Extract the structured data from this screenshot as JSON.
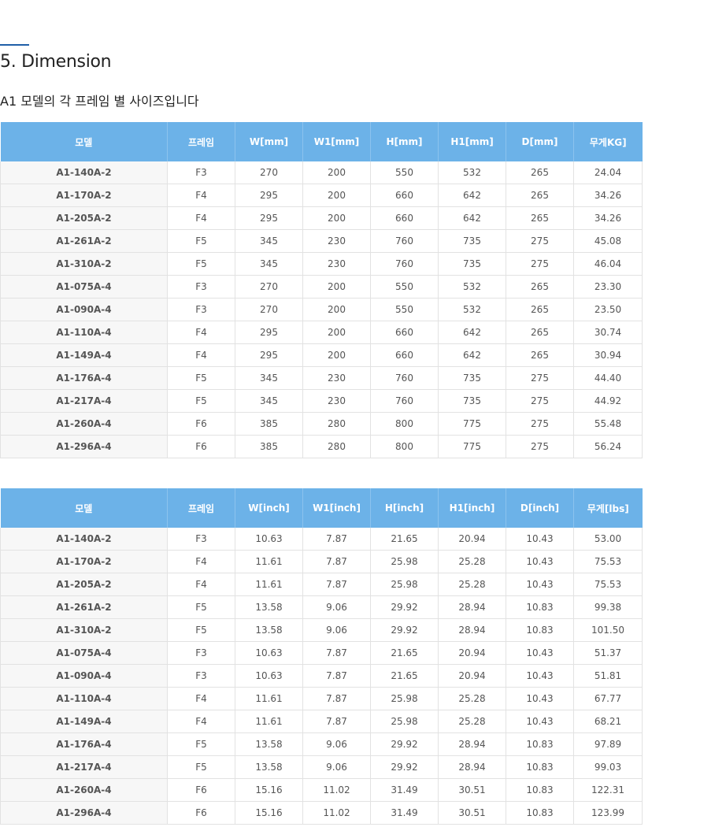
{
  "section": {
    "title": "5. Dimension",
    "subtitle": "A1 모델의 각 프레임 별 사이즈입니다"
  },
  "tables": [
    {
      "headers": [
        "모델",
        "프레임",
        "W[mm]",
        "W1[mm]",
        "H[mm]",
        "H1[mm]",
        "D[mm]",
        "무게KG]"
      ],
      "rows": [
        [
          "A1-140A-2",
          "F3",
          "270",
          "200",
          "550",
          "532",
          "265",
          "24.04"
        ],
        [
          "A1-170A-2",
          "F4",
          "295",
          "200",
          "660",
          "642",
          "265",
          "34.26"
        ],
        [
          "A1-205A-2",
          "F4",
          "295",
          "200",
          "660",
          "642",
          "265",
          "34.26"
        ],
        [
          "A1-261A-2",
          "F5",
          "345",
          "230",
          "760",
          "735",
          "275",
          "45.08"
        ],
        [
          "A1-310A-2",
          "F5",
          "345",
          "230",
          "760",
          "735",
          "275",
          "46.04"
        ],
        [
          "A1-075A-4",
          "F3",
          "270",
          "200",
          "550",
          "532",
          "265",
          "23.30"
        ],
        [
          "A1-090A-4",
          "F3",
          "270",
          "200",
          "550",
          "532",
          "265",
          "23.50"
        ],
        [
          "A1-110A-4",
          "F4",
          "295",
          "200",
          "660",
          "642",
          "265",
          "30.74"
        ],
        [
          "A1-149A-4",
          "F4",
          "295",
          "200",
          "660",
          "642",
          "265",
          "30.94"
        ],
        [
          "A1-176A-4",
          "F5",
          "345",
          "230",
          "760",
          "735",
          "275",
          "44.40"
        ],
        [
          "A1-217A-4",
          "F5",
          "345",
          "230",
          "760",
          "735",
          "275",
          "44.92"
        ],
        [
          "A1-260A-4",
          "F6",
          "385",
          "280",
          "800",
          "775",
          "275",
          "55.48"
        ],
        [
          "A1-296A-4",
          "F6",
          "385",
          "280",
          "800",
          "775",
          "275",
          "56.24"
        ]
      ]
    },
    {
      "headers": [
        "모델",
        "프레임",
        "W[inch]",
        "W1[inch]",
        "H[inch]",
        "H1[inch]",
        "D[inch]",
        "무게[lbs]"
      ],
      "rows": [
        [
          "A1-140A-2",
          "F3",
          "10.63",
          "7.87",
          "21.65",
          "20.94",
          "10.43",
          "53.00"
        ],
        [
          "A1-170A-2",
          "F4",
          "11.61",
          "7.87",
          "25.98",
          "25.28",
          "10.43",
          "75.53"
        ],
        [
          "A1-205A-2",
          "F4",
          "11.61",
          "7.87",
          "25.98",
          "25.28",
          "10.43",
          "75.53"
        ],
        [
          "A1-261A-2",
          "F5",
          "13.58",
          "9.06",
          "29.92",
          "28.94",
          "10.83",
          "99.38"
        ],
        [
          "A1-310A-2",
          "F5",
          "13.58",
          "9.06",
          "29.92",
          "28.94",
          "10.83",
          "101.50"
        ],
        [
          "A1-075A-4",
          "F3",
          "10.63",
          "7.87",
          "21.65",
          "20.94",
          "10.43",
          "51.37"
        ],
        [
          "A1-090A-4",
          "F3",
          "10.63",
          "7.87",
          "21.65",
          "20.94",
          "10.43",
          "51.81"
        ],
        [
          "A1-110A-4",
          "F4",
          "11.61",
          "7.87",
          "25.98",
          "25.28",
          "10.43",
          "67.77"
        ],
        [
          "A1-149A-4",
          "F4",
          "11.61",
          "7.87",
          "25.98",
          "25.28",
          "10.43",
          "68.21"
        ],
        [
          "A1-176A-4",
          "F5",
          "13.58",
          "9.06",
          "29.92",
          "28.94",
          "10.83",
          "97.89"
        ],
        [
          "A1-217A-4",
          "F5",
          "13.58",
          "9.06",
          "29.92",
          "28.94",
          "10.83",
          "99.03"
        ],
        [
          "A1-260A-4",
          "F6",
          "15.16",
          "11.02",
          "31.49",
          "30.51",
          "10.83",
          "122.31"
        ],
        [
          "A1-296A-4",
          "F6",
          "15.16",
          "11.02",
          "31.49",
          "30.51",
          "10.83",
          "123.99"
        ]
      ]
    }
  ],
  "colors": {
    "header_bg": "#6cb2e8",
    "accent_line": "#1f5fa8",
    "model_cell_bg": "#f7f7f7",
    "border": "#e2e2e2"
  }
}
